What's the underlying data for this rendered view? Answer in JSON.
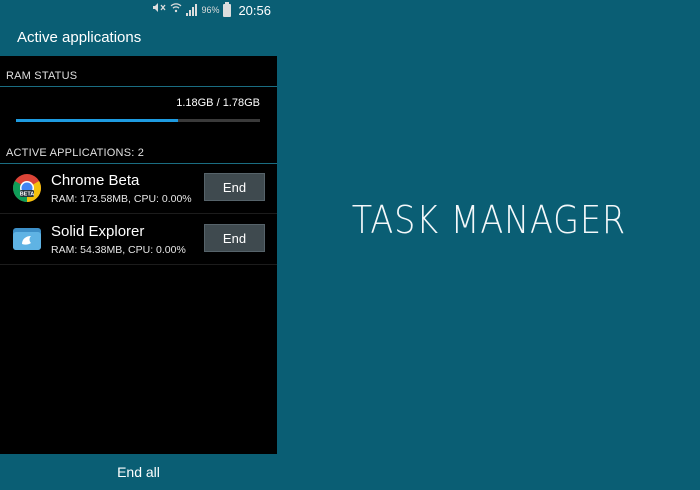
{
  "statusbar": {
    "battery_percent": "96%",
    "time": "20:56",
    "icons": [
      "mute-icon",
      "wifi-icon",
      "signal-icon",
      "battery-icon"
    ]
  },
  "actionbar": {
    "title": "Active applications"
  },
  "ram": {
    "header": "RAM STATUS",
    "value_text": "1.18GB / 1.78GB",
    "used_fraction": 0.663
  },
  "apps": {
    "header": "ACTIVE APPLICATIONS: 2",
    "items": [
      {
        "name": "Chrome Beta",
        "stats": "RAM: 173.58MB, CPU: 0.00%",
        "end_label": "End",
        "icon": "chrome-beta-icon"
      },
      {
        "name": "Solid Explorer",
        "stats": "RAM: 54.38MB, CPU: 0.00%",
        "end_label": "End",
        "icon": "solid-explorer-icon"
      }
    ]
  },
  "footer": {
    "end_all_label": "End all"
  },
  "hero": {
    "title": "TASK MANAGER"
  },
  "colors": {
    "accent": "#0a5e74",
    "progress": "#1e9be0",
    "background": "#000000"
  }
}
